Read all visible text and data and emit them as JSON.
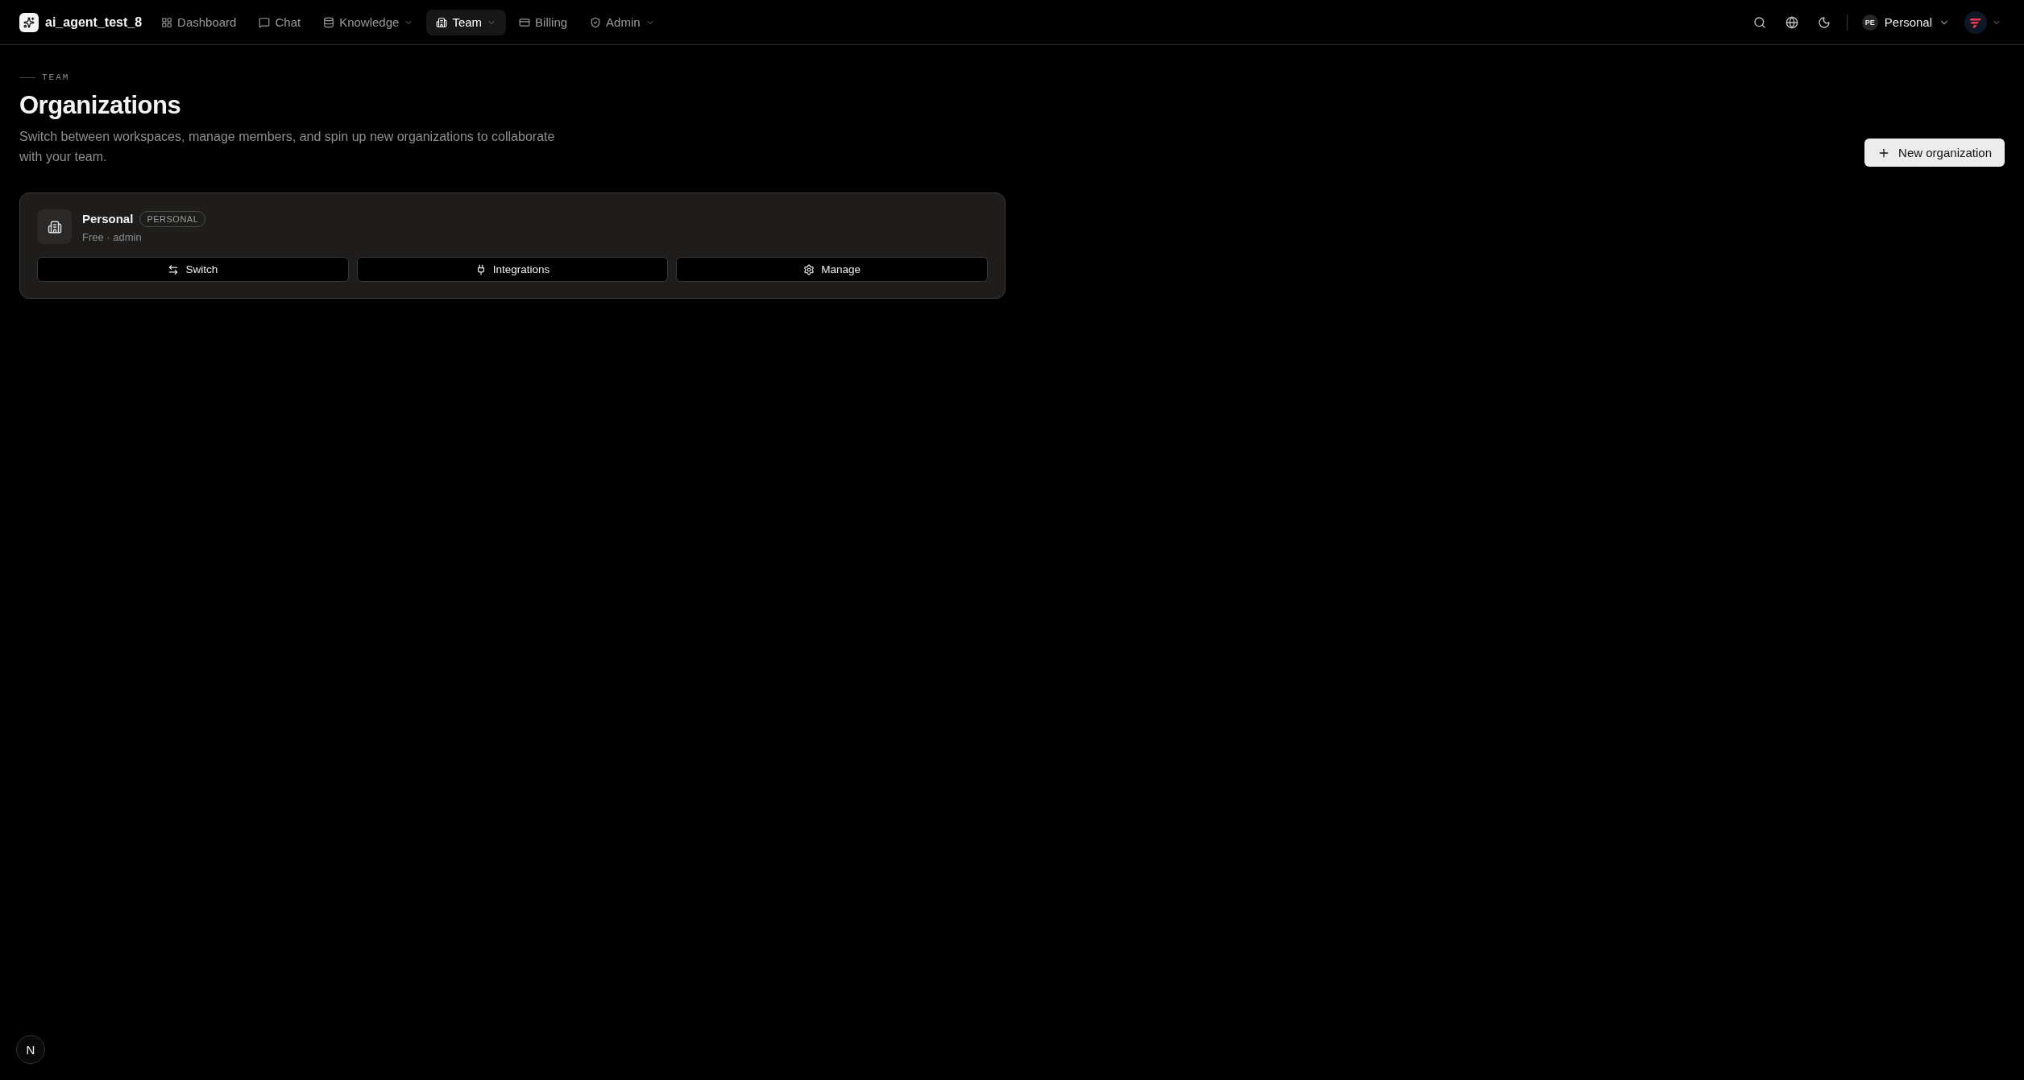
{
  "app": {
    "name": "ai_agent_test_8"
  },
  "nav": [
    {
      "label": "Dashboard",
      "selected": false,
      "dropdown": false
    },
    {
      "label": "Chat",
      "selected": false,
      "dropdown": false
    },
    {
      "label": "Knowledge",
      "selected": false,
      "dropdown": true
    },
    {
      "label": "Team",
      "selected": true,
      "dropdown": true
    },
    {
      "label": "Billing",
      "selected": false,
      "dropdown": false
    },
    {
      "label": "Admin",
      "selected": false,
      "dropdown": true
    }
  ],
  "workspace": {
    "initials": "PE",
    "label": "Personal"
  },
  "page": {
    "eyebrow": "TEAM",
    "title": "Organizations",
    "description": "Switch between workspaces, manage members, and spin up new organizations to collaborate with your team.",
    "action": "New organization"
  },
  "organizations": [
    {
      "name": "Personal",
      "badge": "PERSONAL",
      "meta": "Free · admin",
      "actions": [
        "Switch",
        "Integrations",
        "Manage"
      ]
    }
  ],
  "dev_indicator": "N"
}
